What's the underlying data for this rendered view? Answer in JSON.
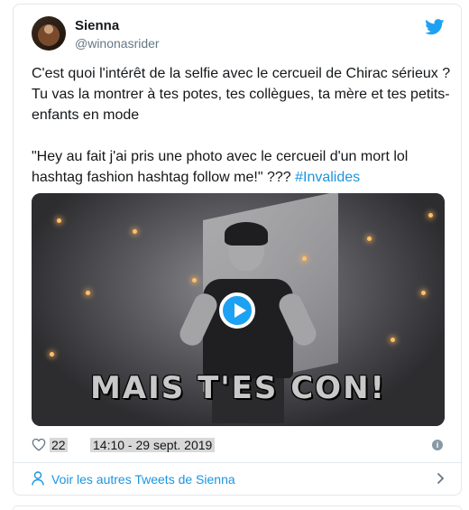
{
  "tweet": {
    "author": {
      "display_name": "Sienna",
      "handle": "@winonasrider",
      "avatar_icon": "user-avatar"
    },
    "brand_icon": "twitter-bird-icon",
    "brand_color": "#1da1f2",
    "text_paragraph_1": "C'est quoi l'intérêt de la selfie avec le cercueil de Chirac sérieux ? Tu vas la montrer à tes potes, tes collègues, ta mère et tes petits-enfants en mode",
    "text_paragraph_2_prefix": "\"Hey au fait j'ai pris une photo avec le cercueil d'un mort lol hashtag fashion hashtag follow me!\" ??? ",
    "hashtag": "#Invalides",
    "hashtag_color": "#1b95e0",
    "media": {
      "caption": "MAIS T'ES CON!",
      "play_icon": "play-icon"
    },
    "likes": "22",
    "timestamp": "14:10 - 29 sept. 2019",
    "info_icon": "info-icon"
  },
  "footer": {
    "label": "Voir les autres Tweets de Sienna",
    "icon": "person-icon",
    "chevron_icon": "chevron-right-icon"
  }
}
